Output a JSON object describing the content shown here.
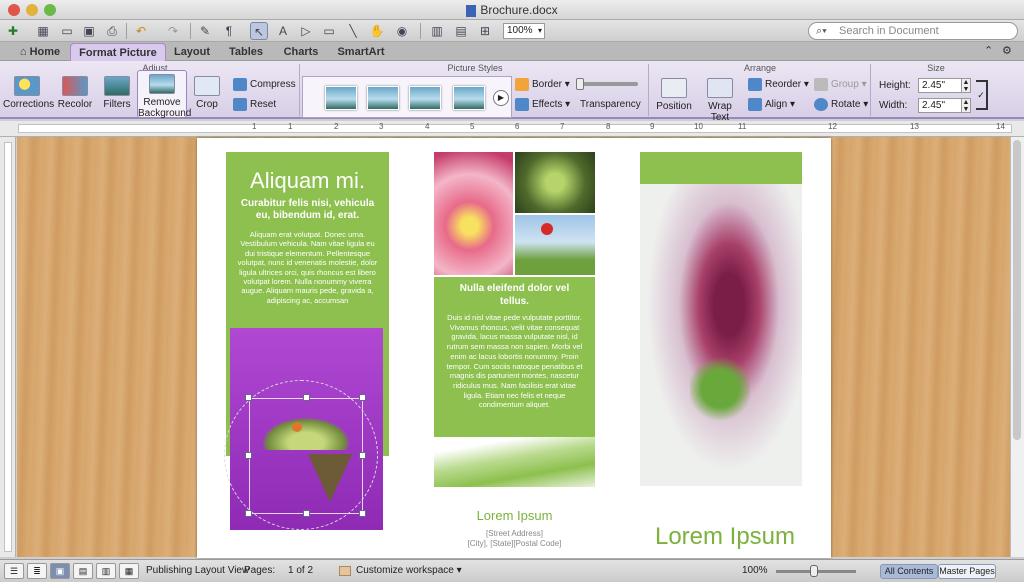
{
  "window": {
    "title": "Brochure.docx"
  },
  "toolbar": {
    "zoom": "100%",
    "search_placeholder": "Search in Document"
  },
  "tabs": [
    {
      "label": "Home"
    },
    {
      "label": "Format Picture"
    },
    {
      "label": "Layout"
    },
    {
      "label": "Tables"
    },
    {
      "label": "Charts"
    },
    {
      "label": "SmartArt"
    }
  ],
  "ribbon": {
    "groups": {
      "adjust": "Adjust",
      "picture_styles": "Picture Styles",
      "arrange": "Arrange",
      "size": "Size"
    },
    "corrections": "Corrections",
    "recolor": "Recolor",
    "filters": "Filters",
    "remove_background_1": "Remove",
    "remove_background_2": "Background",
    "crop": "Crop",
    "compress": "Compress",
    "reset": "Reset",
    "border": "Border",
    "effects": "Effects",
    "transparency": "Transparency",
    "position": "Position",
    "wrap_text": "Wrap Text",
    "reorder": "Reorder",
    "align": "Align",
    "group": "Group",
    "rotate": "Rotate",
    "height_label": "Height:",
    "height_value": "2.45\"",
    "width_label": "Width:",
    "width_value": "2.45\""
  },
  "ruler": {
    "numbers": [
      "1",
      "1",
      "2",
      "3",
      "4",
      "5",
      "6",
      "7",
      "8",
      "9",
      "10",
      "11",
      "12",
      "13",
      "14"
    ]
  },
  "brochure": {
    "col1": {
      "title": "Aliquam mi.",
      "subtitle": "Curabitur felis nisi, vehicula eu, bibendum id, erat.",
      "body": "Aliquam erat volutpat. Donec urna. Vestibulum vehicula. Nam vitae ligula eu dui tristique elementum. Pellentesque volutpat, nunc id venenatis molestie, dolor ligula ultrices orci, quis rhoncus est libero volutpat lorem. Nulla nonummy viverra augue. Aliquam mauris pede, gravida a, adipiscing ac, accumsan"
    },
    "col2": {
      "heading": "Nulla eleifend dolor vel tellus.",
      "body": "Duis id nisl vitae pede vulputate porttitor. Vivamus rhoncus, velit vitae consequat gravida, lacus massa vulputate nisl, id rutrum sem massa non sapien. Morbi vel enim ac lacus lobortis nonummy. Proin tempor. Cum sociis natoque penatibus et magnis dis parturient montes, nascetur ridiculus mus. Nam facilisis erat vitae ligula. Etiam nec felis et neque condimentum aliquet.",
      "footer_title": "Lorem Ipsum",
      "address_line1": "[Street Address]",
      "address_line2": "[City], [State][Postal Code]"
    },
    "col3": {
      "title": "Lorem Ipsum"
    }
  },
  "status": {
    "view": "Publishing Layout View",
    "pages_label": "Pages:",
    "pages_value": "1 of 2",
    "workspace": "Customize workspace",
    "zoom": "100%",
    "all_contents": "All Contents",
    "master_pages": "Master Pages"
  },
  "colors": {
    "accent_green": "#8dc04e",
    "ribbon_purple": "#d8cfe6",
    "selection_purple": "#a030c8"
  }
}
